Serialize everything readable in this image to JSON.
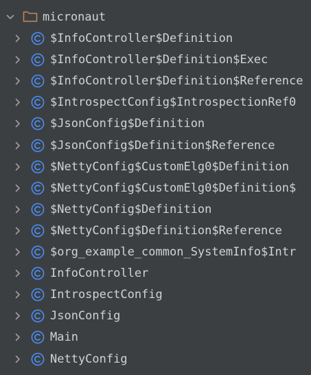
{
  "tree": {
    "folder": {
      "label": "micronaut",
      "expanded": true
    },
    "items": [
      {
        "label": "$InfoController$Definition",
        "type": "class"
      },
      {
        "label": "$InfoController$Definition$Exec",
        "type": "class"
      },
      {
        "label": "$InfoController$Definition$Reference",
        "type": "class"
      },
      {
        "label": "$IntrospectConfig$IntrospectionRef0",
        "type": "class"
      },
      {
        "label": "$JsonConfig$Definition",
        "type": "class"
      },
      {
        "label": "$JsonConfig$Definition$Reference",
        "type": "class"
      },
      {
        "label": "$NettyConfig$CustomElg0$Definition",
        "type": "class"
      },
      {
        "label": "$NettyConfig$CustomElg0$Definition$",
        "type": "class"
      },
      {
        "label": "$NettyConfig$Definition",
        "type": "class"
      },
      {
        "label": "$NettyConfig$Definition$Reference",
        "type": "class"
      },
      {
        "label": "$org_example_common_SystemInfo$Intr",
        "type": "class"
      },
      {
        "label": "InfoController",
        "type": "class"
      },
      {
        "label": "IntrospectConfig",
        "type": "class"
      },
      {
        "label": "JsonConfig",
        "type": "class"
      },
      {
        "label": "Main",
        "type": "class"
      },
      {
        "label": "NettyConfig",
        "type": "class"
      }
    ]
  },
  "icons": {
    "class_icon_letter": "C",
    "folder": "folder-icon",
    "chevron_collapsed": "chevron-right-icon",
    "chevron_expanded": "chevron-down-icon"
  },
  "colors": {
    "background": "#3c3f41",
    "text": "#d2d2d2",
    "chevron": "#9da0a2",
    "class_icon": "#4a8df5",
    "folder_stroke": "#c08a5a"
  }
}
